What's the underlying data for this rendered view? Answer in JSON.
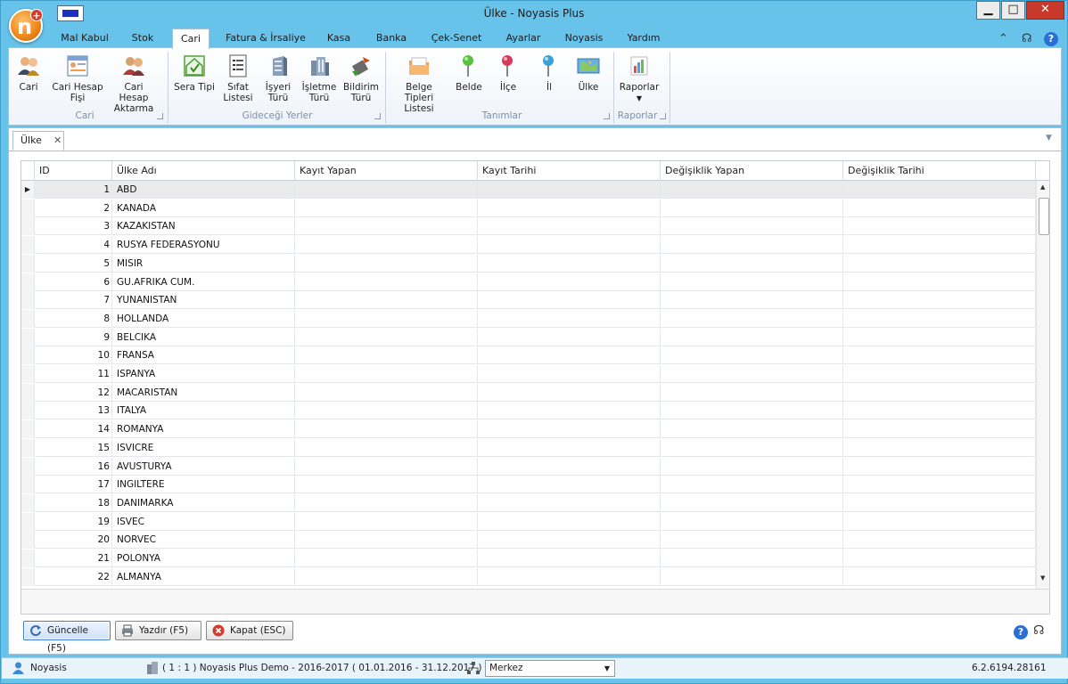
{
  "window": {
    "title": "Ülke - Noyasis Plus"
  },
  "tabs": [
    {
      "label": "Mal Kabul",
      "active": false
    },
    {
      "label": "Stok",
      "active": false
    },
    {
      "label": "Cari",
      "active": true
    },
    {
      "label": "Fatura & İrsaliye",
      "active": false
    },
    {
      "label": "Kasa",
      "active": false
    },
    {
      "label": "Banka",
      "active": false
    },
    {
      "label": "Çek-Senet",
      "active": false
    },
    {
      "label": "Ayarlar",
      "active": false
    },
    {
      "label": "Noyasis",
      "active": false
    },
    {
      "label": "Yardım",
      "active": false
    }
  ],
  "ribbon": {
    "cari": {
      "btn1": "Cari",
      "btn2a": "Cari Hesap",
      "btn2b": "Fişi",
      "btn3a": "Cari Hesap",
      "btn3b": "Aktarma",
      "group": "Cari"
    },
    "gidecegi": {
      "b1": "Sera Tipi",
      "b2a": "Sıfat",
      "b2b": "Listesi",
      "b3a": "İşyeri",
      "b3b": "Türü",
      "b4a": "İşletme",
      "b4b": "Türü",
      "b5a": "Bildirim",
      "b5b": "Türü",
      "group": "Gideceği Yerler"
    },
    "tanimlar": {
      "b1a": "Belge Tipleri",
      "b1b": "Listesi",
      "b2": "Belde",
      "b3": "İlçe",
      "b4": "İl",
      "b5": "Ülke",
      "group": "Tanımlar"
    },
    "raporlar": {
      "b1": "Raporlar",
      "group": "Raporlar"
    }
  },
  "doc_tab": {
    "label": "Ülke",
    "close": "✕"
  },
  "grid": {
    "headers": [
      "ID",
      "Ülke Adı",
      "Kayıt Yapan",
      "Kayıt Tarihi",
      "Değişiklik Yapan",
      "Değişiklik Tarihi"
    ],
    "rows": [
      {
        "id": "1",
        "name": "ABD"
      },
      {
        "id": "2",
        "name": "KANADA"
      },
      {
        "id": "3",
        "name": "KAZAKISTAN"
      },
      {
        "id": "4",
        "name": "RUSYA FEDERASYONU"
      },
      {
        "id": "5",
        "name": "MISIR"
      },
      {
        "id": "6",
        "name": "GU.AFRIKA CUM."
      },
      {
        "id": "7",
        "name": "YUNANISTAN"
      },
      {
        "id": "8",
        "name": "HOLLANDA"
      },
      {
        "id": "9",
        "name": "BELCIKA"
      },
      {
        "id": "10",
        "name": "FRANSA"
      },
      {
        "id": "11",
        "name": "ISPANYA"
      },
      {
        "id": "12",
        "name": "MACARISTAN"
      },
      {
        "id": "13",
        "name": "ITALYA"
      },
      {
        "id": "14",
        "name": "ROMANYA"
      },
      {
        "id": "15",
        "name": "ISVICRE"
      },
      {
        "id": "16",
        "name": "AVUSTURYA"
      },
      {
        "id": "17",
        "name": "INGILTERE"
      },
      {
        "id": "18",
        "name": "DANIMARKA"
      },
      {
        "id": "19",
        "name": "ISVEC"
      },
      {
        "id": "20",
        "name": "NORVEC"
      },
      {
        "id": "21",
        "name": "POLONYA"
      },
      {
        "id": "22",
        "name": "ALMANYA"
      }
    ]
  },
  "buttons": {
    "refresh": "Güncelle (F5)",
    "print": "Yazdır (F5)",
    "close": "Kapat (ESC)"
  },
  "status": {
    "user": "Noyasis",
    "company": "( 1 : 1 )  Noyasis Plus Demo - 2016-2017  ( 01.01.2016 - 31.12.2017 )",
    "branch": "Merkez",
    "version": "6.2.6194.28161"
  },
  "colors": {
    "frame": "#68c3ea",
    "accent": "#2a6fd6",
    "close": "#c7392b"
  }
}
